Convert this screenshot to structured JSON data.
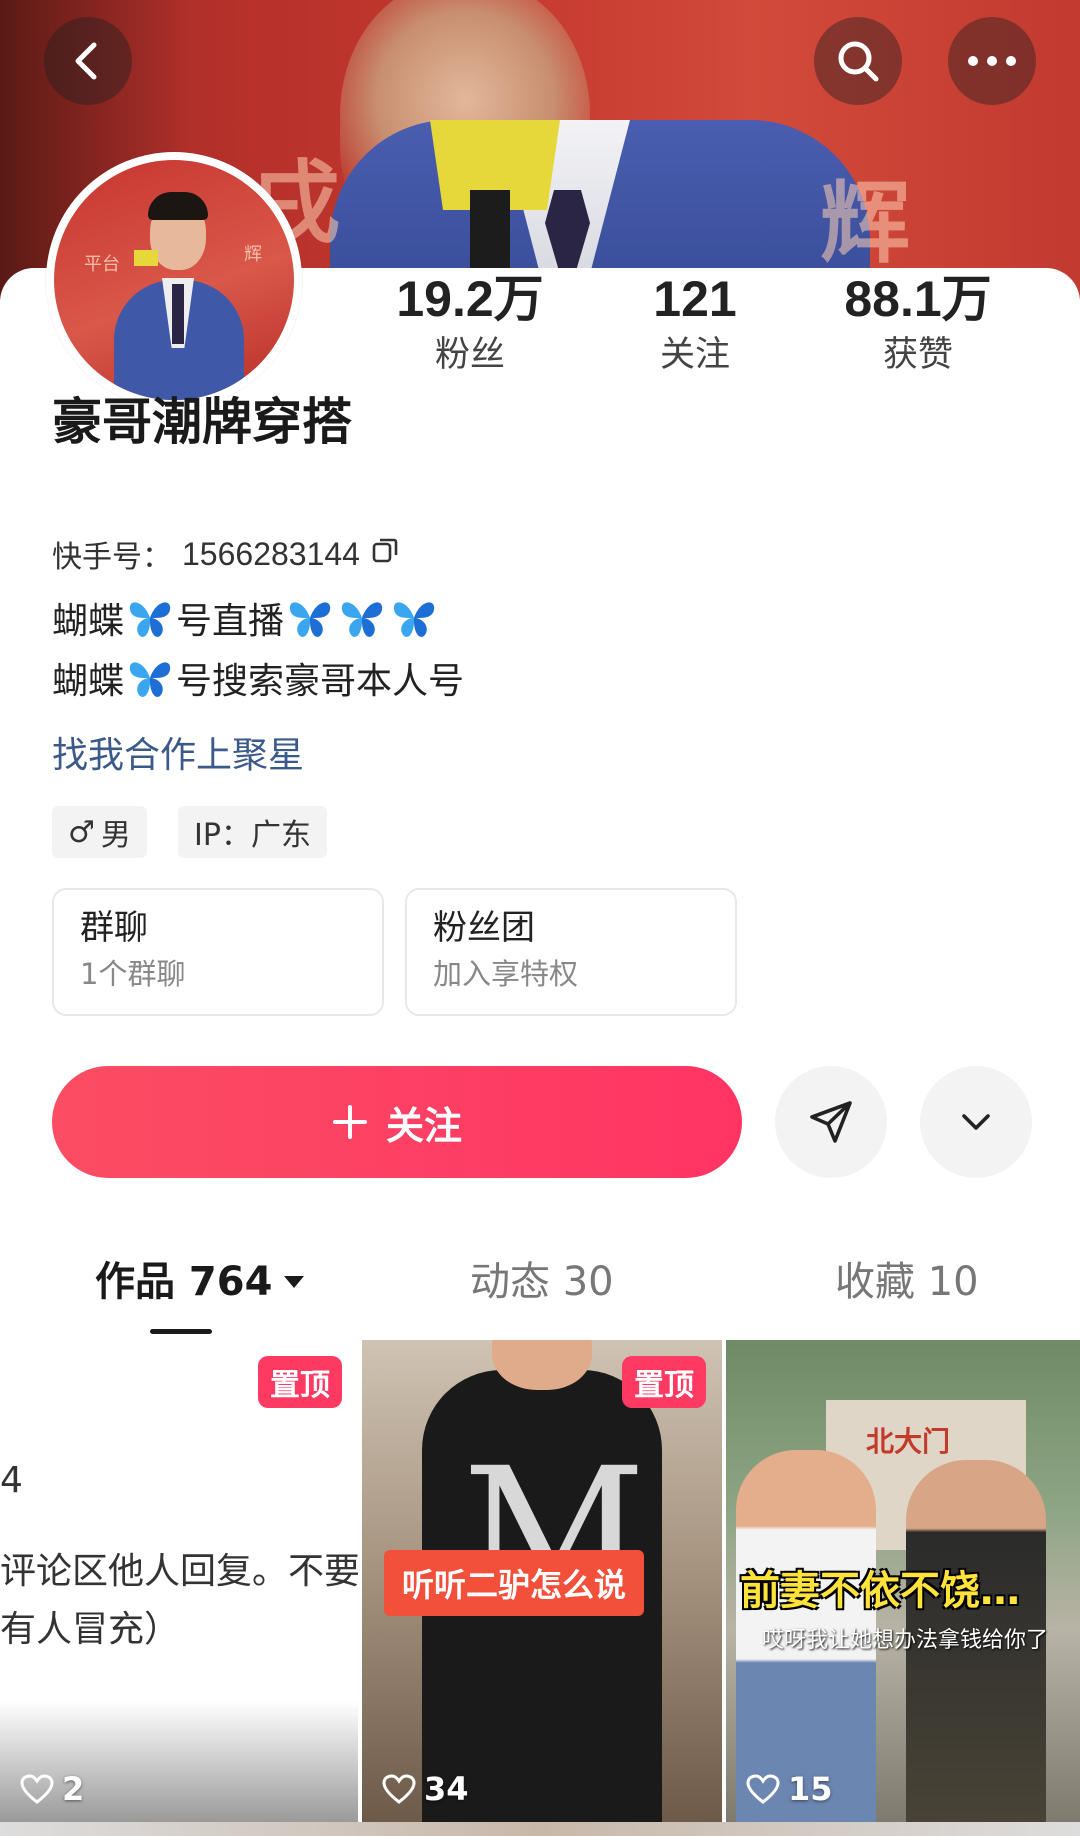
{
  "header": {
    "back_icon": "chevron-left-icon",
    "search_icon": "search-icon",
    "more_icon": "more-horizontal-icon"
  },
  "profile": {
    "name": "豪哥潮牌穿搭",
    "kuaishou_label": "快手号：",
    "kuaishou_id": "1566283144",
    "bio_line1_a": "蝴蝶",
    "bio_line1_b": "号直播",
    "bio_line2_a": "蝴蝶",
    "bio_line2_b": "号搜索豪哥本人号",
    "link": "找我合作上聚星",
    "gender_symbol": "♂",
    "gender": "男",
    "ip": "IP：广东"
  },
  "stats": [
    {
      "value": "19.2万",
      "label": "粉丝"
    },
    {
      "value": "121",
      "label": "关注"
    },
    {
      "value": "88.1万",
      "label": "获赞"
    }
  ],
  "cards": [
    {
      "title": "群聊",
      "subtitle": "1个群聊"
    },
    {
      "title": "粉丝团",
      "subtitle": "加入享特权"
    }
  ],
  "actions": {
    "follow_label": "关注",
    "share_icon": "send-icon",
    "expand_icon": "chevron-down-icon"
  },
  "tabs": [
    {
      "label": "作品 764"
    },
    {
      "label": "动态 30"
    },
    {
      "label": "收藏 10"
    }
  ],
  "videos": [
    {
      "pinned": "置顶",
      "likes": "2",
      "text_lines": [
        "4",
        "评论区他人回复。不要",
        "有人冒充）"
      ]
    },
    {
      "pinned": "置顶",
      "likes": "34",
      "caption": "听听二驴怎么说"
    },
    {
      "likes": "15",
      "caption": "前妻不依不饶…",
      "subcaption": "哎呀我让她想办法拿钱给你了",
      "sign": "北大门"
    }
  ],
  "banner_text": [
    "戌",
    "辉"
  ],
  "colors": {
    "accent": "#fe3a62",
    "link": "#3b5a8a"
  }
}
